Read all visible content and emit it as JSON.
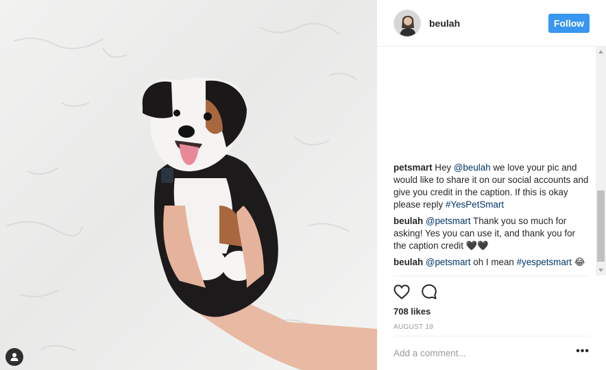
{
  "post": {
    "author": "beulah",
    "follow_label": "Follow",
    "likes": "708 likes",
    "date": "AUGUST 19",
    "add_comment_placeholder": "Add a comment...",
    "more_options": "•••"
  },
  "comments": [
    {
      "author": "petsmart",
      "parts": [
        {
          "t": "Hey ",
          "link": false
        },
        {
          "t": "@beulah",
          "link": true
        },
        {
          "t": " we love your pic and would like to share it on our social accounts and give you credit in the caption. If this is okay please reply ",
          "link": false
        },
        {
          "t": "#YesPetSmart",
          "link": true
        }
      ]
    },
    {
      "author": "beulah",
      "parts": [
        {
          "t": "@petsmart",
          "link": true
        },
        {
          "t": " Thank you so much for asking! Yes you can use it, and thank you for the caption credit ",
          "link": false
        },
        {
          "t": "🖤🖤",
          "link": false
        }
      ]
    },
    {
      "author": "beulah",
      "parts": [
        {
          "t": "@petsmart",
          "link": true
        },
        {
          "t": " oh I mean ",
          "link": false
        },
        {
          "t": "#yespetsmart",
          "link": true
        },
        {
          "t": " 😂",
          "link": false
        }
      ]
    }
  ],
  "icons": {
    "like": "heart-icon",
    "comment": "speech-bubble-icon",
    "user_tag": "person-icon"
  },
  "colors": {
    "accent": "#3897f0",
    "link": "#003569",
    "muted": "#999999"
  }
}
